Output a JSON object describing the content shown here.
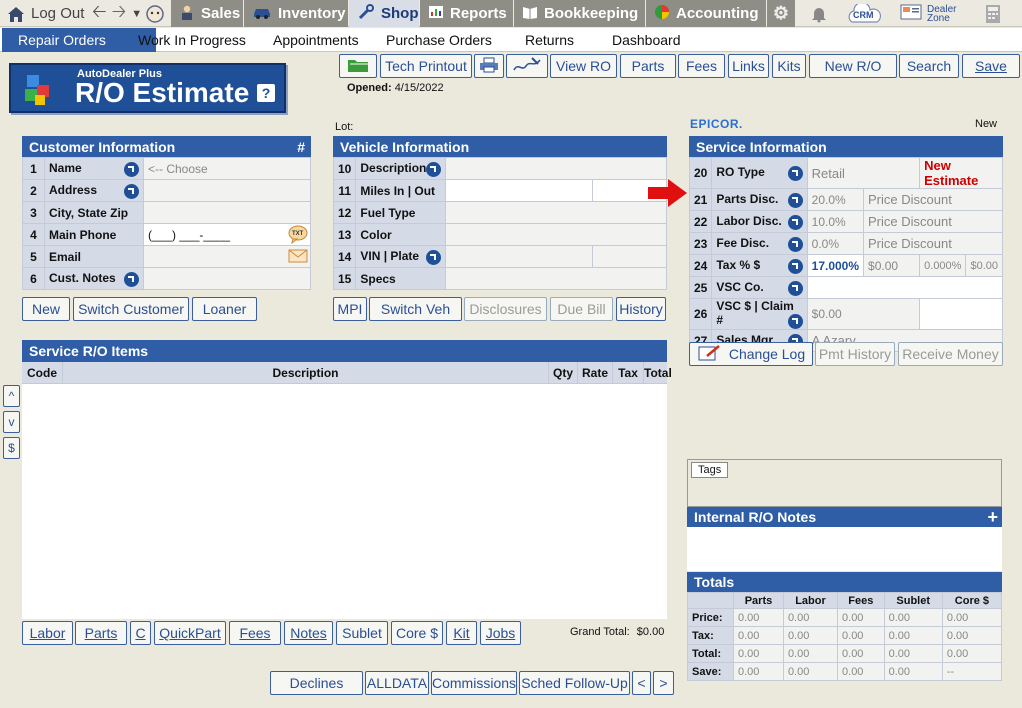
{
  "topbar": {
    "logout": "Log Out",
    "tabs": [
      "Sales",
      "Inventory",
      "Shop",
      "Reports",
      "Bookkeeping",
      "Accounting"
    ],
    "crm": "CRM",
    "dealer_zone_1": "Dealer",
    "dealer_zone_2": "Zone"
  },
  "subnav": [
    "Repair Orders",
    "Work In Progress",
    "Appointments",
    "Purchase Orders",
    "Returns",
    "Dashboard"
  ],
  "logo": {
    "small": "AutoDealer Plus",
    "big": "R/O Estimate",
    "help": "?"
  },
  "toolbar": {
    "tech_printout": "Tech Printout",
    "view_ro": "View RO",
    "parts": "Parts",
    "fees": "Fees",
    "links": "Links",
    "kits": "Kits",
    "new_ro": "New R/O",
    "search": "Search",
    "save": "Save"
  },
  "opened_label": "Opened:",
  "opened_date": "4/15/2022",
  "lot_label": "Lot:",
  "epicor": "EPICOR.",
  "status_new": "New",
  "customer": {
    "title": "Customer Information",
    "hash": "#",
    "rows": [
      {
        "n": "1",
        "label": "Name",
        "value": "<-- Choose"
      },
      {
        "n": "2",
        "label": "Address",
        "value": ""
      },
      {
        "n": "3",
        "label": "City, State Zip",
        "value": ""
      },
      {
        "n": "4",
        "label": "Main Phone",
        "value": "(___) ___-____"
      },
      {
        "n": "5",
        "label": "Email",
        "value": ""
      },
      {
        "n": "6",
        "label": "Cust. Notes",
        "value": ""
      }
    ],
    "buttons": [
      "New",
      "Switch Customer",
      "Loaner"
    ],
    "txt_badge": "TXT"
  },
  "vehicle": {
    "title": "Vehicle Information",
    "rows": [
      {
        "n": "10",
        "label": "Description"
      },
      {
        "n": "11",
        "label": "Miles  In | Out"
      },
      {
        "n": "12",
        "label": "Fuel Type"
      },
      {
        "n": "13",
        "label": "Color"
      },
      {
        "n": "14",
        "label": "VIN | Plate"
      },
      {
        "n": "15",
        "label": "Specs"
      }
    ],
    "buttons": [
      "MPI",
      "Switch Veh",
      "Disclosures",
      "Due Bill",
      "History"
    ]
  },
  "service": {
    "title": "Service Information",
    "rows": [
      {
        "n": "20",
        "label": "RO Type",
        "v1": "Retail",
        "v2": "New Estimate"
      },
      {
        "n": "21",
        "label": "Parts Disc.",
        "v1": "20.0%",
        "v2": "Price Discount"
      },
      {
        "n": "22",
        "label": "Labor Disc.",
        "v1": "10.0%",
        "v2": "Price Discount"
      },
      {
        "n": "23",
        "label": "Fee Disc.",
        "v1": "0.0%",
        "v2": "Price Discount"
      },
      {
        "n": "24",
        "label": "Tax % $",
        "v1": "17.000%",
        "v2": "$0.00",
        "v3": "0.000%",
        "v4": "$0.00"
      },
      {
        "n": "25",
        "label": "VSC  Co.",
        "v1": ""
      },
      {
        "n": "26",
        "label": "VSC $ | Claim #",
        "v1": "$0.00"
      },
      {
        "n": "27",
        "label": "Sales Mgr",
        "v1": "A Azary"
      }
    ],
    "buttons": [
      "Change Log",
      "Pmt History",
      "Receive Money"
    ]
  },
  "items": {
    "title": "Service R/O Items",
    "columns": [
      "Code",
      "Description",
      "Qty",
      "Rate",
      "Tax",
      "Total"
    ],
    "side_buttons": [
      "^",
      "v",
      "$"
    ],
    "bottom_buttons": [
      "Labor",
      "Parts",
      "C",
      "QuickPart",
      "Fees",
      "Notes",
      "Sublet",
      "Core $",
      "Kit",
      "Jobs"
    ],
    "grand_total_label": "Grand Total:",
    "grand_total": "$0.00"
  },
  "footer_buttons": [
    "Declines",
    "ALLDATA",
    "Commissions",
    "Sched Follow-Up",
    "<",
    ">"
  ],
  "tags": {
    "label": "Tags"
  },
  "notes": {
    "title": "Internal R/O Notes",
    "add": "+"
  },
  "totals": {
    "title": "Totals",
    "columns": [
      "Parts",
      "Labor",
      "Fees",
      "Sublet",
      "Core $"
    ],
    "rows": [
      {
        "label": "Price:",
        "values": [
          "0.00",
          "0.00",
          "0.00",
          "0.00",
          "0.00"
        ]
      },
      {
        "label": "Tax:",
        "values": [
          "0.00",
          "0.00",
          "0.00",
          "0.00",
          "0.00"
        ]
      },
      {
        "label": "Total:",
        "values": [
          "0.00",
          "0.00",
          "0.00",
          "0.00",
          "0.00"
        ]
      },
      {
        "label": "Save:",
        "values": [
          "0.00",
          "0.00",
          "0.00",
          "0.00",
          "--"
        ]
      }
    ]
  },
  "colors": {
    "accent": "#2f5ea6",
    "arrow": "#e01010",
    "new_estimate": "#d00000"
  }
}
